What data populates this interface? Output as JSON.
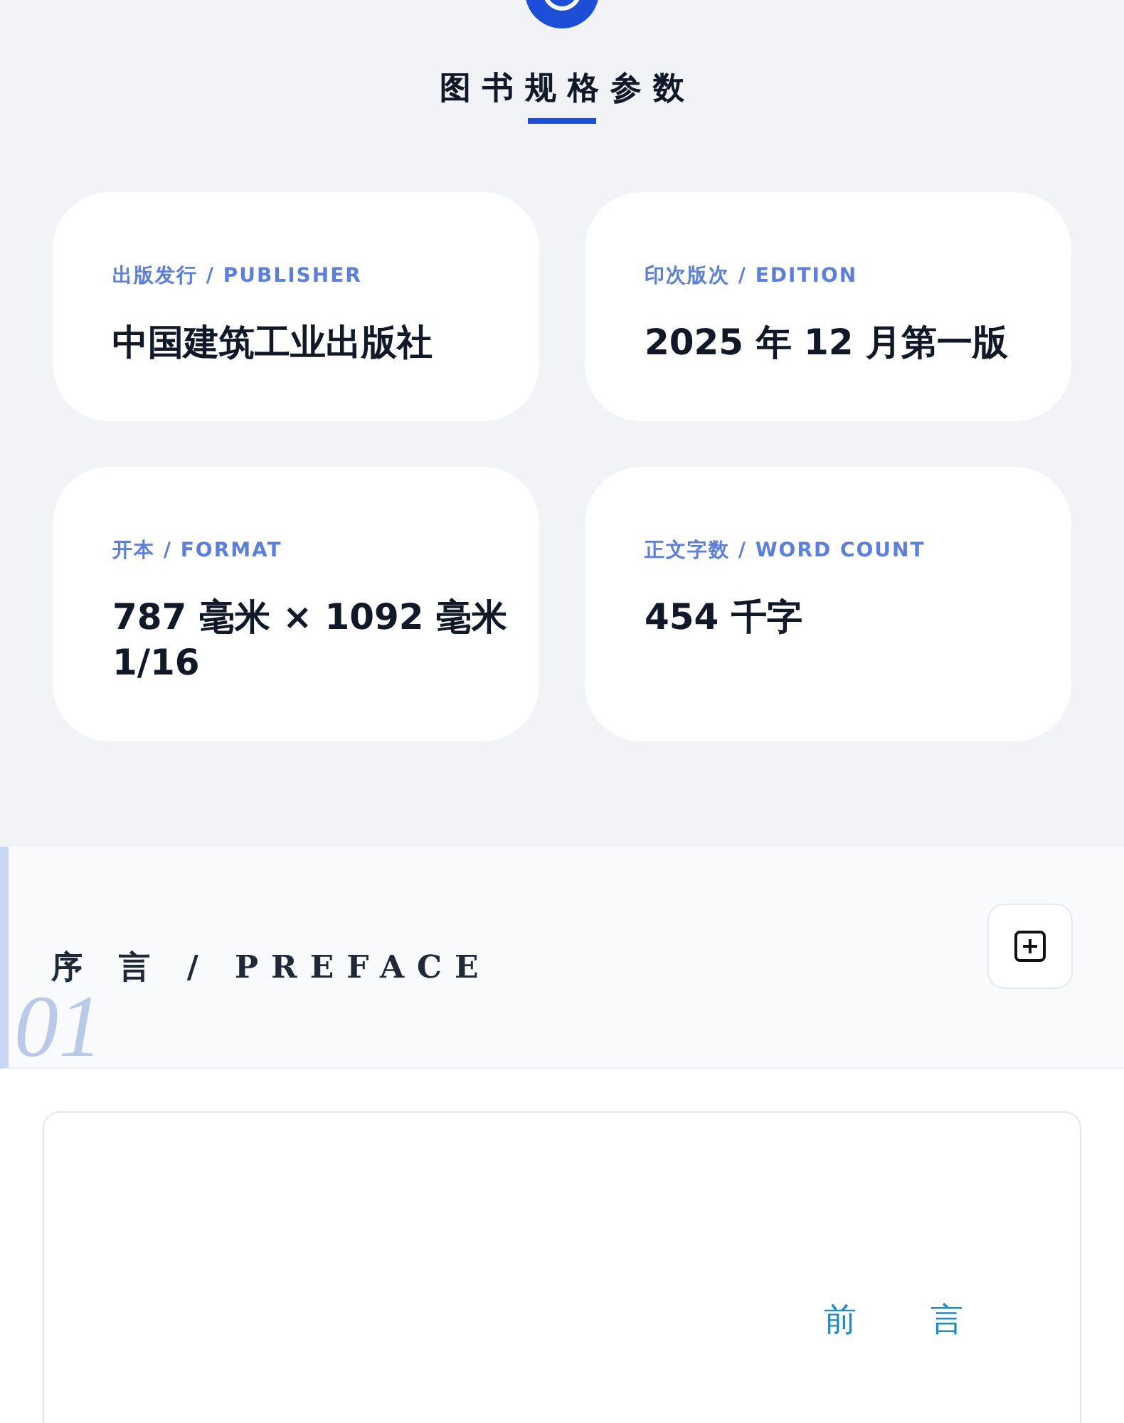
{
  "specs": {
    "title": "图书规格参数",
    "items": [
      {
        "label": "出版发行 / PUBLISHER",
        "value": "中国建筑工业出版社"
      },
      {
        "label": "印次版次 / EDITION",
        "value": "2025 年 12 月第一版"
      },
      {
        "label": "开本 / FORMAT",
        "value": "787 毫米 × 1092 毫米 1/16"
      },
      {
        "label": "正文字数 / WORD COUNT",
        "value": "454 千字"
      }
    ]
  },
  "preface": {
    "number": "01",
    "title": "序 言 / PREFACE",
    "content_heading": "前　　言"
  }
}
